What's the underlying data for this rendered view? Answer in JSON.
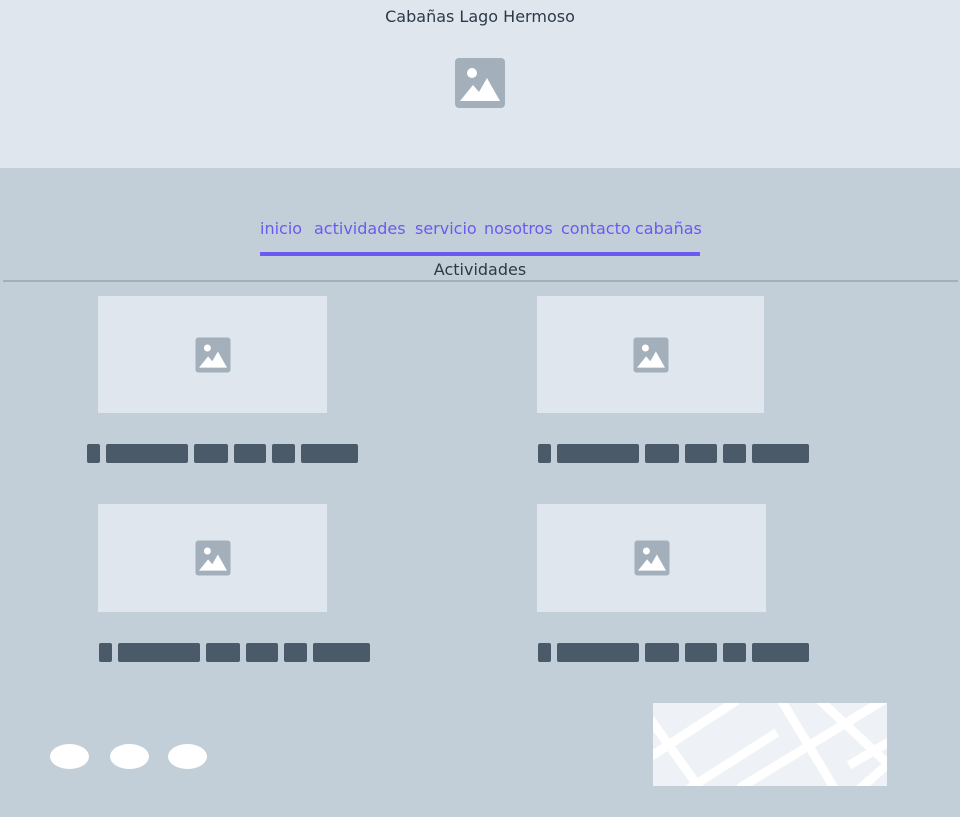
{
  "header": {
    "title": "Cabañas Lago Hermoso",
    "hero_icon": "image-placeholder-icon"
  },
  "nav": {
    "items": [
      {
        "label": "inicio"
      },
      {
        "label": "actividades"
      },
      {
        "label": "servicio"
      },
      {
        "label": "nosotros"
      },
      {
        "label": "contacto"
      },
      {
        "label": "cabañas"
      }
    ]
  },
  "section": {
    "title": "Actividades"
  },
  "cards": [
    {
      "image_icon": "image-placeholder-icon"
    },
    {
      "image_icon": "image-placeholder-icon"
    },
    {
      "image_icon": "image-placeholder-icon"
    },
    {
      "image_icon": "image-placeholder-icon"
    }
  ],
  "footer": {
    "social_icons": [
      "social-icon",
      "social-icon",
      "social-icon"
    ],
    "map_icon": "map-placeholder"
  },
  "colors": {
    "header_bg": "#dfe6ee",
    "page_bg": "#c3cfd8",
    "accent": "#6a5af0",
    "text_dark": "#2c3a48",
    "placeholder_text": "#4a5a68",
    "icon_gray": "#a3b0bb"
  }
}
